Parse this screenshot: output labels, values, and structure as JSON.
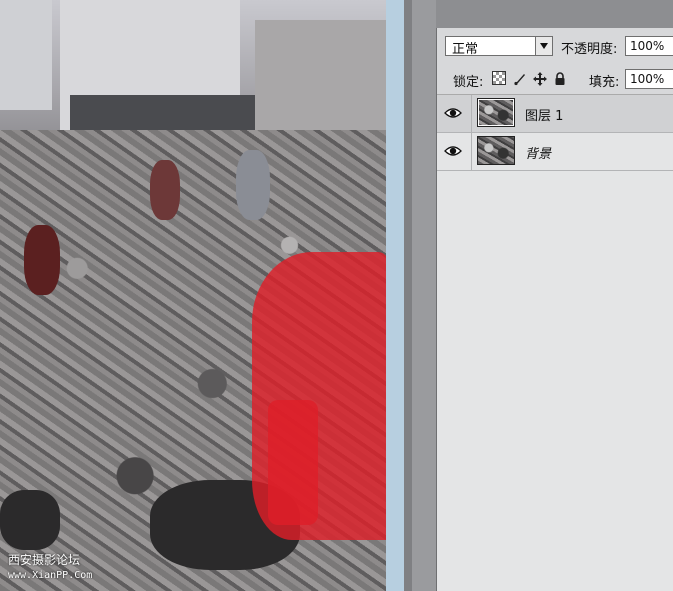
{
  "canvas": {
    "watermark_line1": "西安摄影论坛",
    "watermark_line2": "www.XianPP.Com"
  },
  "layers_panel": {
    "blend_mode": "正常",
    "opacity_label": "不透明度:",
    "opacity_value": "100%",
    "lock_label": "锁定:",
    "fill_label": "填充:",
    "fill_value": "100%",
    "layers": [
      {
        "name": "图层 1",
        "selected": true,
        "visible": true
      },
      {
        "name": "背景",
        "selected": false,
        "visible": true
      }
    ]
  },
  "icons": {
    "lock_transparent": "lock-transparent-pixels-icon",
    "lock_image": "brush-icon",
    "lock_position": "move-icon",
    "lock_all": "lock-icon",
    "visibility": "eye-icon",
    "dropdown": "triangle-down-icon"
  },
  "colors": {
    "mask_overlay": "#de1e28",
    "panel_bg": "#e4e5e6",
    "selected_row": "#d0d1d3"
  }
}
